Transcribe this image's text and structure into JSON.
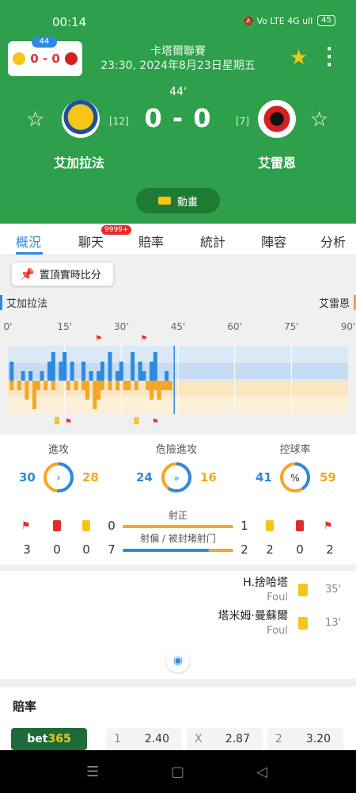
{
  "status": {
    "time": "00:14",
    "icons": "🔕 Vo LTE 4G ull",
    "battery": "45"
  },
  "mini": {
    "minute": "44",
    "score": "0 - 0"
  },
  "match": {
    "league": "卡塔爾聯賽",
    "datetime": "23:30, 2024年8月23日星期五",
    "minute": "44'",
    "score": "0 - 0",
    "home": {
      "name": "艾加拉法",
      "rank": "[12]",
      "color": "#f5c518"
    },
    "away": {
      "name": "艾雷恩",
      "rank": "[7]",
      "color": "#d42020"
    },
    "animation_label": "動畫"
  },
  "tabs": [
    "概況",
    "聊天",
    "賠率",
    "統計",
    "陣容",
    "分析"
  ],
  "chat_badge": "9999+",
  "pin_label": "置頂實時比分",
  "timeline": {
    "home_label": "艾加拉法",
    "away_label": "艾雷恩",
    "ticks": [
      "0'",
      "15'",
      "30'",
      "45'",
      "60'",
      "75'",
      "90'"
    ]
  },
  "chart_data": {
    "type": "bar",
    "title": "",
    "xlabel": "",
    "ylabel": "",
    "series": [
      {
        "name": "艾加拉法",
        "color": "#2e8ae0",
        "minutes": [
          1,
          4,
          6,
          9,
          11,
          12,
          14,
          15,
          17,
          20,
          22,
          24,
          25,
          27,
          29,
          30,
          33,
          35,
          36,
          38,
          39,
          42
        ],
        "values": [
          2,
          1,
          1,
          1,
          2,
          3,
          2,
          3,
          2,
          2,
          1,
          1,
          2,
          3,
          1,
          2,
          3,
          2,
          1,
          2,
          3,
          1
        ]
      },
      {
        "name": "艾雷恩",
        "color": "#f5a623",
        "minutes": [
          1,
          3,
          5,
          7,
          8,
          10,
          12,
          16,
          18,
          20,
          21,
          23,
          24,
          25,
          27,
          29,
          31,
          32,
          34,
          37,
          38,
          39,
          40,
          41,
          42,
          43
        ],
        "values": [
          1,
          1,
          2,
          3,
          1,
          1,
          1,
          1,
          1,
          1,
          2,
          3,
          2,
          1,
          1,
          1,
          1,
          1,
          1,
          1,
          2,
          1,
          2,
          1,
          1,
          1
        ]
      }
    ],
    "markers_home": [
      {
        "minute": 24,
        "type": "corner"
      },
      {
        "minute": 36,
        "type": "corner"
      }
    ],
    "markers_away": [
      {
        "minute": 13,
        "type": "yellow"
      },
      {
        "minute": 16,
        "type": "corner"
      },
      {
        "minute": 34,
        "type": "yellow"
      },
      {
        "minute": 39,
        "type": "corner"
      }
    ],
    "current_minute": 44,
    "xlim": [
      0,
      90
    ]
  },
  "stats": {
    "attack": {
      "label": "進攻",
      "home": "30",
      "away": "28"
    },
    "danger": {
      "label": "危險進攻",
      "home": "24",
      "away": "16"
    },
    "possession": {
      "label": "控球率",
      "home": "41",
      "away": "59",
      "icon": "%"
    },
    "home_corners": "3",
    "home_red": "0",
    "home_yellow": "0",
    "away_corners": "2",
    "away_red": "0",
    "away_yellow": "2",
    "on_target": {
      "label": "射正",
      "home": "0",
      "away": "1"
    },
    "off_target": {
      "label": "射偏 / 被封堵射门",
      "home": "7",
      "away": "2"
    }
  },
  "events": [
    {
      "player": "H.捨哈塔",
      "note": "Foul",
      "minute": "35'"
    },
    {
      "player": "塔米姆·曼蘇爾",
      "note": "Foul",
      "minute": "13'"
    }
  ],
  "odds": {
    "title": "賠率",
    "bookmaker_a": "bet",
    "bookmaker_b": "365",
    "home_key": "1",
    "home": "2.40",
    "draw_key": "X",
    "draw": "2.87",
    "away_key": "2",
    "away": "3.20"
  }
}
